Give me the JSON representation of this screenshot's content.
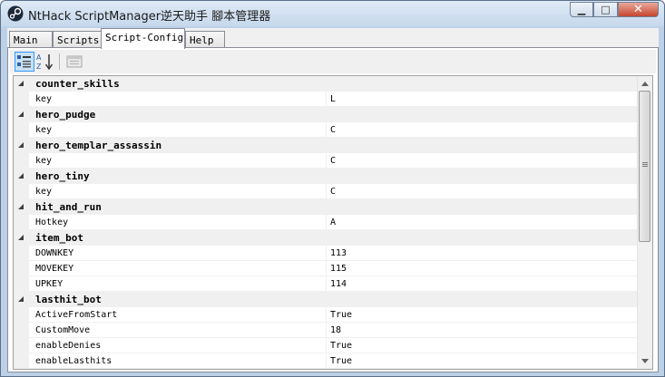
{
  "window": {
    "title": "NtHack ScriptManager逆天助手 腳本管理器",
    "minimize_glyph": "▁",
    "maximize_glyph": "□",
    "close_glyph": "✕"
  },
  "tabs": [
    {
      "label": "Main",
      "active": false
    },
    {
      "label": "Scripts",
      "active": false
    },
    {
      "label": "Script-Config",
      "active": true
    },
    {
      "label": "Help",
      "active": false
    }
  ],
  "toolbar": {
    "categorized_icon": "categorized-view-icon",
    "alphabetical_icon": "alphabetical-sort-icon",
    "property_pages_icon": "property-pages-icon"
  },
  "property_grid": {
    "categories": [
      {
        "name": "counter_skills",
        "props": [
          {
            "name": "key",
            "value": "L"
          }
        ]
      },
      {
        "name": "hero_pudge",
        "props": [
          {
            "name": "key",
            "value": "C"
          }
        ]
      },
      {
        "name": "hero_templar_assassin",
        "props": [
          {
            "name": "key",
            "value": "C"
          }
        ]
      },
      {
        "name": "hero_tiny",
        "props": [
          {
            "name": "key",
            "value": "C"
          }
        ]
      },
      {
        "name": "hit_and_run",
        "props": [
          {
            "name": "Hotkey",
            "value": "A"
          }
        ]
      },
      {
        "name": "item_bot",
        "props": [
          {
            "name": "DOWNKEY",
            "value": "113"
          },
          {
            "name": "MOVEKEY",
            "value": "115"
          },
          {
            "name": "UPKEY",
            "value": "114"
          }
        ]
      },
      {
        "name": "lasthit_bot",
        "props": [
          {
            "name": "ActiveFromStart",
            "value": "True"
          },
          {
            "name": "CustomMove",
            "value": "18"
          },
          {
            "name": "enableDenies",
            "value": "True"
          },
          {
            "name": "enableLasthits",
            "value": "True"
          }
        ]
      }
    ]
  },
  "colors": {
    "accent": "#3399ff",
    "category_bg": "#f0f0f0",
    "close_button": "#c7462f"
  }
}
